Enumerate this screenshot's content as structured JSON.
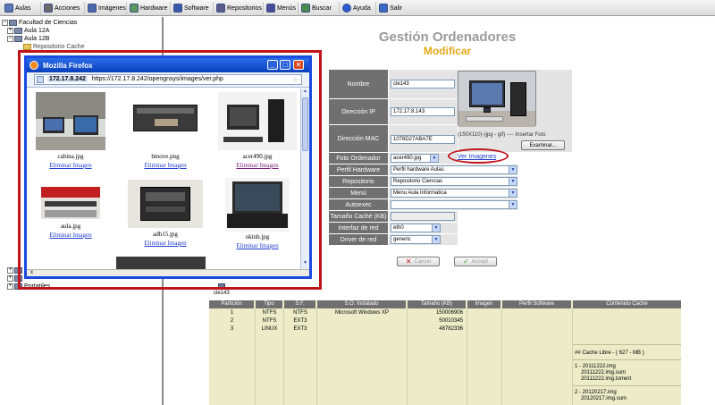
{
  "menu": [
    {
      "label": "Aulas",
      "icon": "classroom-icon"
    },
    {
      "label": "Acciones",
      "icon": "actions-icon"
    },
    {
      "label": "Imágenes",
      "icon": "images-icon"
    },
    {
      "label": "Hardware",
      "icon": "hardware-icon"
    },
    {
      "label": "Software",
      "icon": "software-icon"
    },
    {
      "label": "Repositorios",
      "icon": "repositories-icon"
    },
    {
      "label": "Menús",
      "icon": "menus-icon"
    },
    {
      "label": "Buscar",
      "icon": "search-icon"
    },
    {
      "label": "Ayuda",
      "icon": "help-icon"
    },
    {
      "label": "Salir",
      "icon": "exit-icon"
    }
  ],
  "tree": {
    "root": "Facultad de Ciencias",
    "items": [
      "Aula 12A",
      "Aula 12B",
      "Repositorio Cache"
    ],
    "bottom_item": "Portatiles"
  },
  "heading": {
    "title": "Gestión Ordenadores",
    "subtitle": "Modificar"
  },
  "form": {
    "nombre_label": "Nombre",
    "nombre": "cle143",
    "ip_label": "Dirección IP",
    "ip": "172.17.8.143",
    "mac_label": "Dirección MAC",
    "mac": "1078D27ABA7E",
    "photo_hint": "(150X110)-(jpg - gif) ---- Insertar Foto",
    "browse_button": "Examinar...",
    "foto_label": "Foto Ordenador",
    "foto": "acer490.jpg",
    "ver_imagenes": "Ver Imagenes",
    "perfil_label": "Perfil Hardware",
    "perfil": "Perfil hardware Aulas",
    "repo_label": "Repositorio",
    "repo": "Repositorio Ciencias",
    "menu_label": "Menú",
    "menu": "Menu Aula Informatica",
    "autoexec_label": "Autoexec",
    "autoexec": "",
    "cache_label": "Tamaño Caché (KB)",
    "cache": "",
    "red_label": "Interfaz de red",
    "red": "eth0",
    "driver_label": "Driver de red",
    "driver": "generic"
  },
  "buttons": {
    "cancel": "Cancel",
    "accept": "Accept"
  },
  "popup": {
    "title": "Mozilla Firefox",
    "url_host": "172.17.8.242",
    "url_full": "https://172.17.8.242/opengnsys/images/ver.php",
    "delete_label": "Eliminar Imagen",
    "images": [
      "cabina.jpg",
      "bmove.png",
      "acer490.jpg",
      "aula.jpg",
      "adb15.jpg",
      "okinb.jpg"
    ],
    "status": "x"
  },
  "computer_label": "cle143",
  "table": {
    "headers": [
      "Partición",
      "Tipo",
      "S.F.",
      "S.O. Instalado",
      "Tamaño (KB)",
      "Imagen",
      "Perfil Software",
      "Contenido Cache"
    ],
    "rows": [
      [
        "1",
        "NTFS",
        "NTFS",
        "Microsoft Windows XP",
        "150006906"
      ],
      [
        "2",
        "NTFS",
        "EXT3",
        "",
        "50010345"
      ],
      [
        "3",
        "LINUX",
        "EXT3",
        "",
        "48782336"
      ]
    ],
    "cache_free": "## Cache Libre - ( 627 - MB )",
    "cache_entries": [
      {
        "title": "1 - 20111222.img",
        "files": [
          "20111222.img.sum",
          "20111222.img.torrent"
        ]
      },
      {
        "title": "2 - 20120217.img",
        "files": [
          "20120217.img.sum"
        ]
      }
    ]
  }
}
